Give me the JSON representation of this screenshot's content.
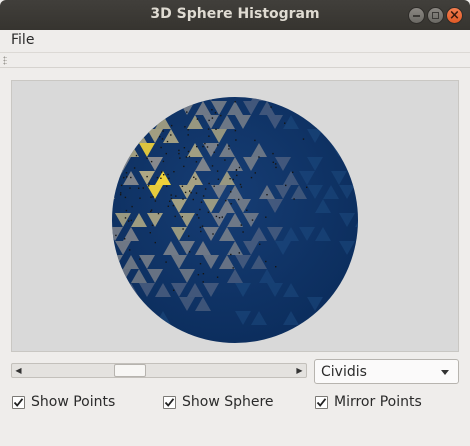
{
  "window": {
    "title": "3D Sphere Histogram"
  },
  "menubar": {
    "items": [
      {
        "label": "File"
      }
    ]
  },
  "viewport": {
    "background": "#d9d9d9",
    "sphere_color": "#0f3466",
    "highlight_color": "#f2d43a"
  },
  "scrollbar": {
    "value_fraction": 0.36
  },
  "colormap": {
    "selected": "Cividis"
  },
  "options": {
    "show_points": {
      "label": "Show Points",
      "checked": true
    },
    "show_sphere": {
      "label": "Show Sphere",
      "checked": true
    },
    "mirror_points": {
      "label": "Mirror Points",
      "checked": true
    }
  }
}
